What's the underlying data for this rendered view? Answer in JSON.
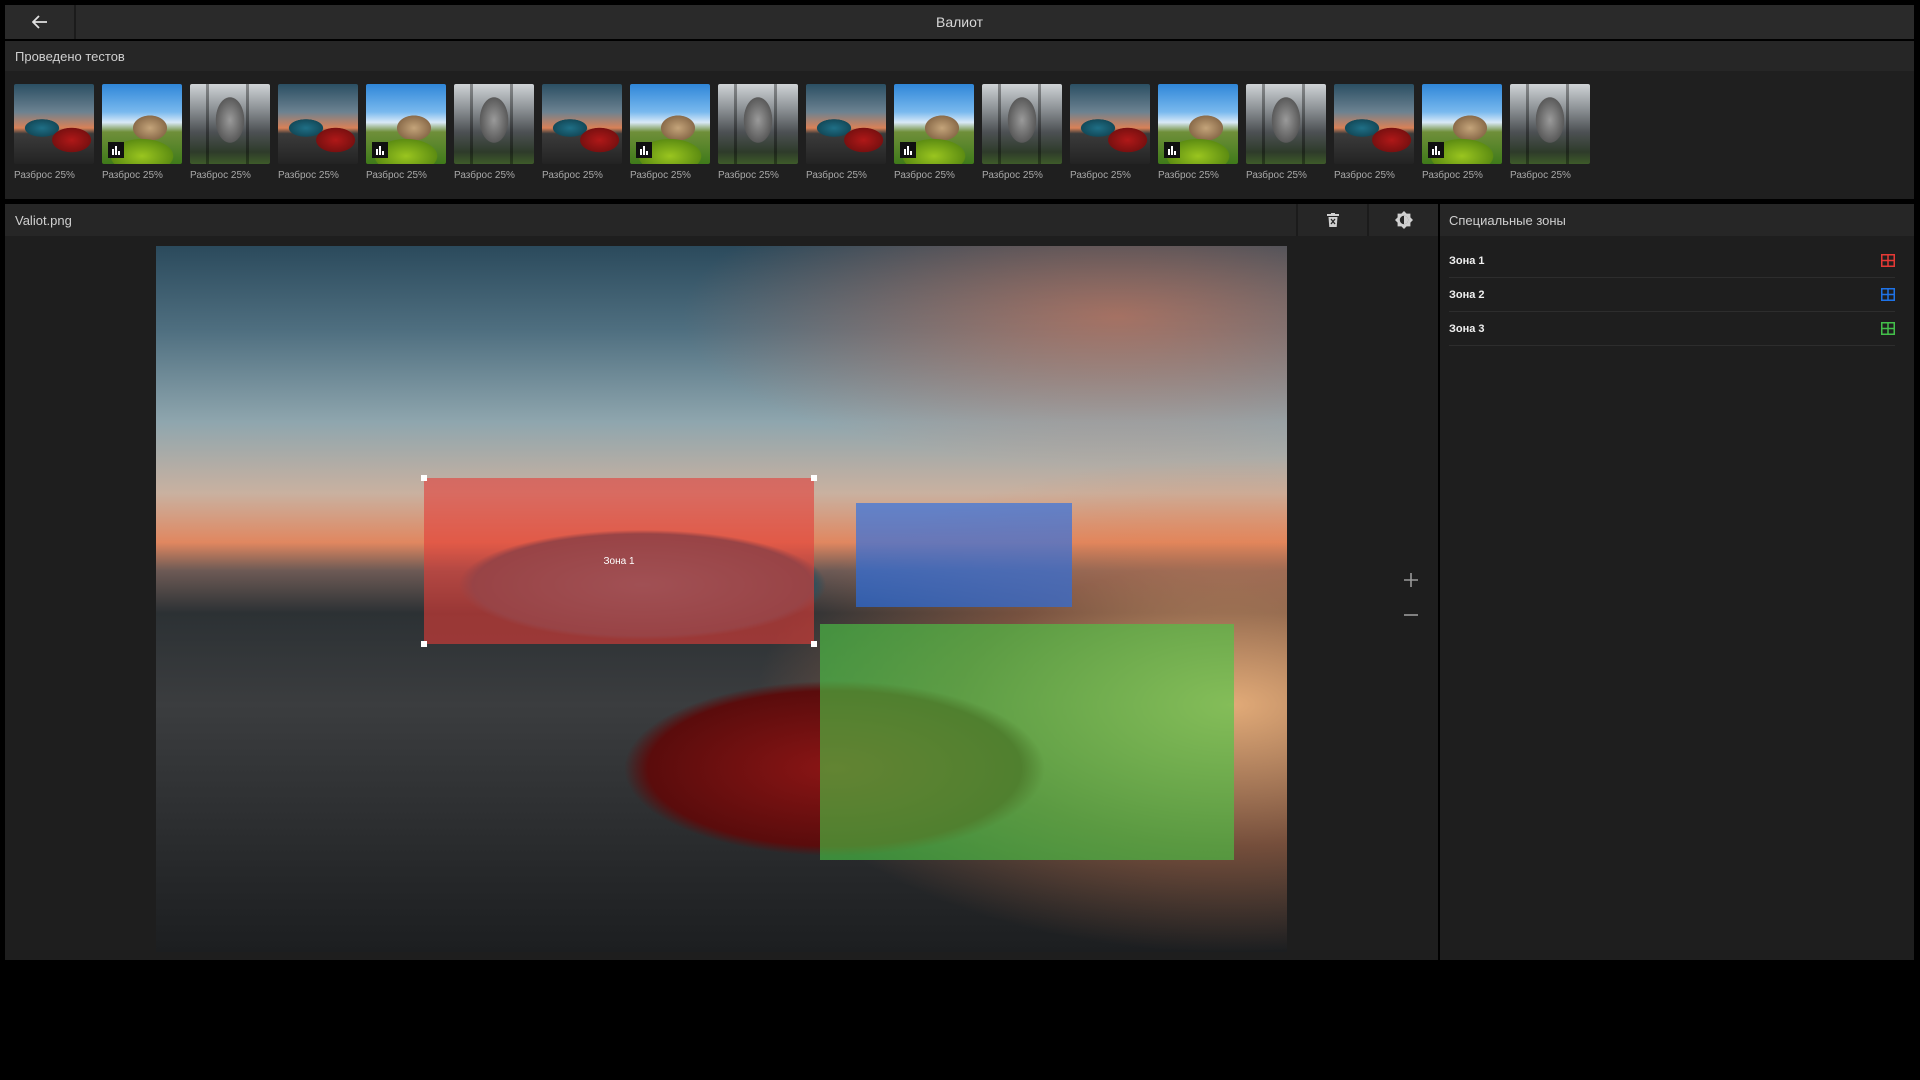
{
  "header": {
    "title": "Валиот",
    "back_icon": "arrow-left-icon"
  },
  "tests": {
    "title": "Проведено тестов",
    "items": [
      {
        "label": "Разброс 25%",
        "kind": "car",
        "has_chart": false
      },
      {
        "label": "Разброс 25%",
        "kind": "land",
        "has_chart": true
      },
      {
        "label": "Разброс 25%",
        "kind": "church",
        "has_chart": false
      },
      {
        "label": "Разброс 25%",
        "kind": "car",
        "has_chart": false
      },
      {
        "label": "Разброс 25%",
        "kind": "land",
        "has_chart": true
      },
      {
        "label": "Разброс 25%",
        "kind": "church",
        "has_chart": false
      },
      {
        "label": "Разброс 25%",
        "kind": "car",
        "has_chart": false
      },
      {
        "label": "Разброс 25%",
        "kind": "land",
        "has_chart": true
      },
      {
        "label": "Разброс 25%",
        "kind": "church",
        "has_chart": false
      },
      {
        "label": "Разброс 25%",
        "kind": "car",
        "has_chart": false
      },
      {
        "label": "Разброс 25%",
        "kind": "land",
        "has_chart": true
      },
      {
        "label": "Разброс 25%",
        "kind": "church",
        "has_chart": false
      },
      {
        "label": "Разброс 25%",
        "kind": "car",
        "has_chart": false
      },
      {
        "label": "Разброс 25%",
        "kind": "land",
        "has_chart": true
      },
      {
        "label": "Разброс 25%",
        "kind": "church",
        "has_chart": false
      },
      {
        "label": "Разброс 25%",
        "kind": "car",
        "has_chart": false
      },
      {
        "label": "Разброс 25%",
        "kind": "land",
        "has_chart": true
      },
      {
        "label": "Разброс 25%",
        "kind": "church",
        "has_chart": false
      }
    ]
  },
  "workspace": {
    "filename": "Valiot.png",
    "delete_icon": "trash-icon",
    "brightness_icon": "brightness-icon",
    "zoom_in_icon": "plus-icon",
    "zoom_out_icon": "minus-icon",
    "zone_overlay_label": "Зона 1"
  },
  "zones": {
    "title": "Специальные зоны",
    "items": [
      {
        "name": "Зона 1",
        "color": "#e53935",
        "icon": "grid-icon"
      },
      {
        "name": "Зона 2",
        "color": "#1e73e8",
        "icon": "grid-icon"
      },
      {
        "name": "Зона 3",
        "color": "#43c04a",
        "icon": "grid-icon"
      }
    ]
  },
  "colors": {
    "zone_red": "rgba(226,60,55,0.60)",
    "zone_blue": "rgba(40,110,230,0.65)",
    "zone_green": "rgba(75,200,70,0.62)"
  }
}
